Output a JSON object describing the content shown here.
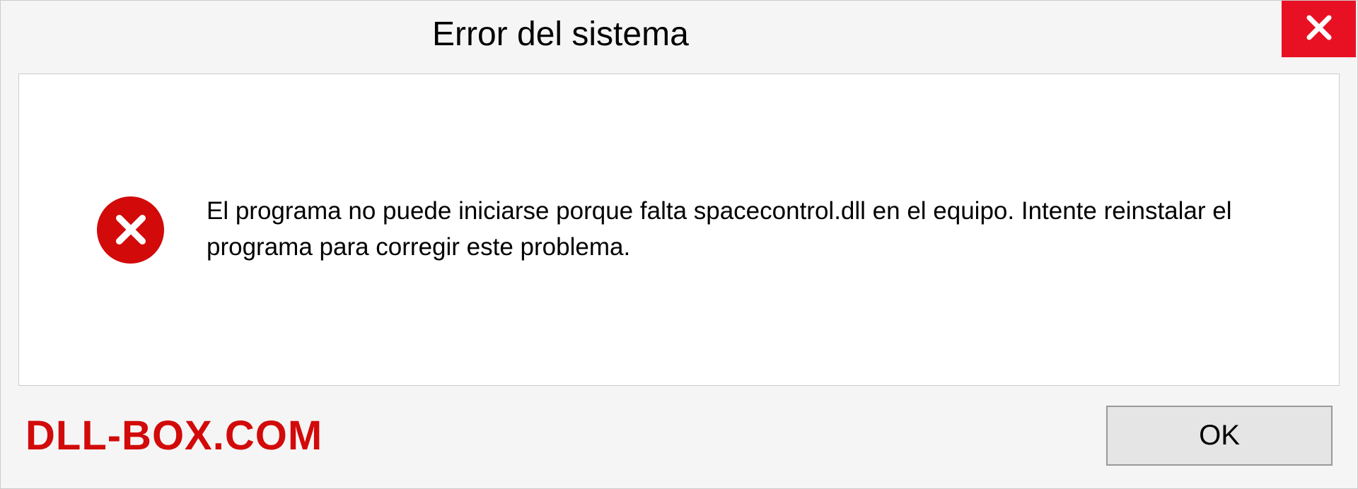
{
  "dialog": {
    "title": "Error del sistema",
    "message": "El programa no puede iniciarse porque falta spacecontrol.dll en el equipo. Intente reinstalar el programa para corregir este problema.",
    "ok_label": "OK"
  },
  "watermark": "DLL-BOX.COM"
}
